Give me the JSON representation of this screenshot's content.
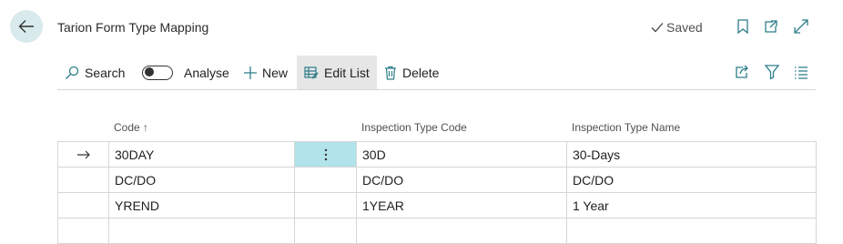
{
  "header": {
    "title": "Tarion Form Type Mapping",
    "saved_label": "Saved"
  },
  "toolbar": {
    "search_label": "Search",
    "analyse_label": "Analyse",
    "new_label": "New",
    "edit_list_label": "Edit List",
    "delete_label": "Delete"
  },
  "table": {
    "columns": [
      "Code",
      "Inspection Type Code",
      "Inspection Type Name"
    ],
    "sort_indicator": "↑",
    "rows": [
      {
        "code": "30DAY",
        "inspection_type_code": "30D",
        "inspection_type_name": "30-Days"
      },
      {
        "code": "DC/DO",
        "inspection_type_code": "DC/DO",
        "inspection_type_name": "DC/DO"
      },
      {
        "code": "YREND",
        "inspection_type_code": "1YEAR",
        "inspection_type_name": "1 Year"
      },
      {
        "code": "",
        "inspection_type_code": "",
        "inspection_type_name": ""
      }
    ]
  },
  "icons": {
    "back": "arrow-left-icon",
    "saved": "checkmark-icon",
    "bookmark": "bookmark-icon",
    "open_new": "open-in-new-window-icon",
    "expand": "expand-icon",
    "search": "search-icon",
    "new": "plus-icon",
    "edit_list": "edit-list-icon",
    "delete": "trash-icon",
    "share": "share-icon",
    "filter": "filter-icon",
    "list": "list-view-icon",
    "row_current": "arrow-right-icon",
    "row_menu": "more-vertical-icon"
  },
  "colors": {
    "accent": "#d9eaec",
    "selected_cell": "#b1e3ea",
    "border": "#d6d6d6"
  }
}
